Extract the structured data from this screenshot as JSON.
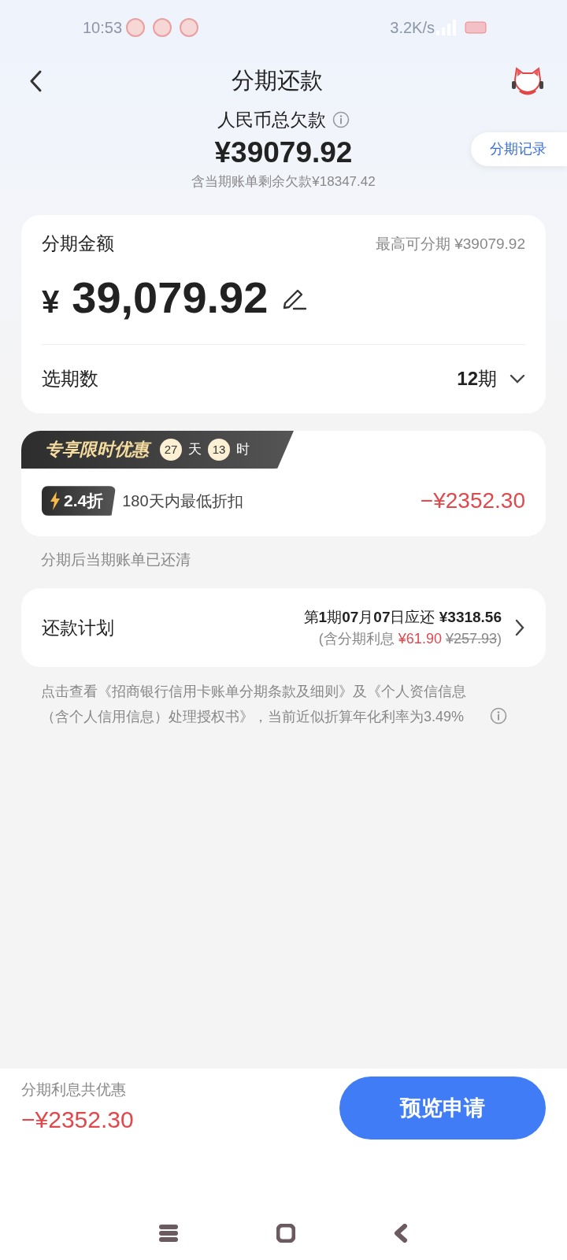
{
  "status_bar": {
    "time": "10:53",
    "speed": "3.2K/s"
  },
  "header": {
    "title": "分期还款"
  },
  "summary": {
    "label": "人民币总欠款",
    "amount": "¥39079.92",
    "note": "含当期账单剩余欠款¥18347.42"
  },
  "records_button": "分期记录",
  "amount_card": {
    "label": "分期金额",
    "max_label": "最高可分期 ¥39079.92",
    "currency": "¥",
    "amount": "39,079.92",
    "period_label": "选期数",
    "period_value": "**12**期"
  },
  "promo": {
    "title": "专享限时优惠",
    "countdown": [
      {
        "value": "27",
        "unit": "天"
      },
      {
        "value": "13",
        "unit": "时"
      }
    ],
    "discount": "2.4折",
    "description": "180天内最低折扣",
    "saving": "−¥2352.30"
  },
  "note": "分期后当期账单已还清",
  "plan": {
    "label": "还款计划",
    "first_payment": "第**1**期**07**月**07**日应还 **¥3318.56**",
    "interest_prefix": "(含分期利息 ",
    "interest": "¥61.90",
    "original_interest": "¥257.93",
    "interest_suffix": ")"
  },
  "legal": "点击查看《招商银行信用卡账单分期条款及细则》及《个人资信信息（含个人信用信息）处理授权书》，当前近似折算年化利率为3.49%",
  "footer": {
    "label": "分期利息共优惠",
    "saving": "−¥2352.30",
    "button": "预览申请"
  }
}
